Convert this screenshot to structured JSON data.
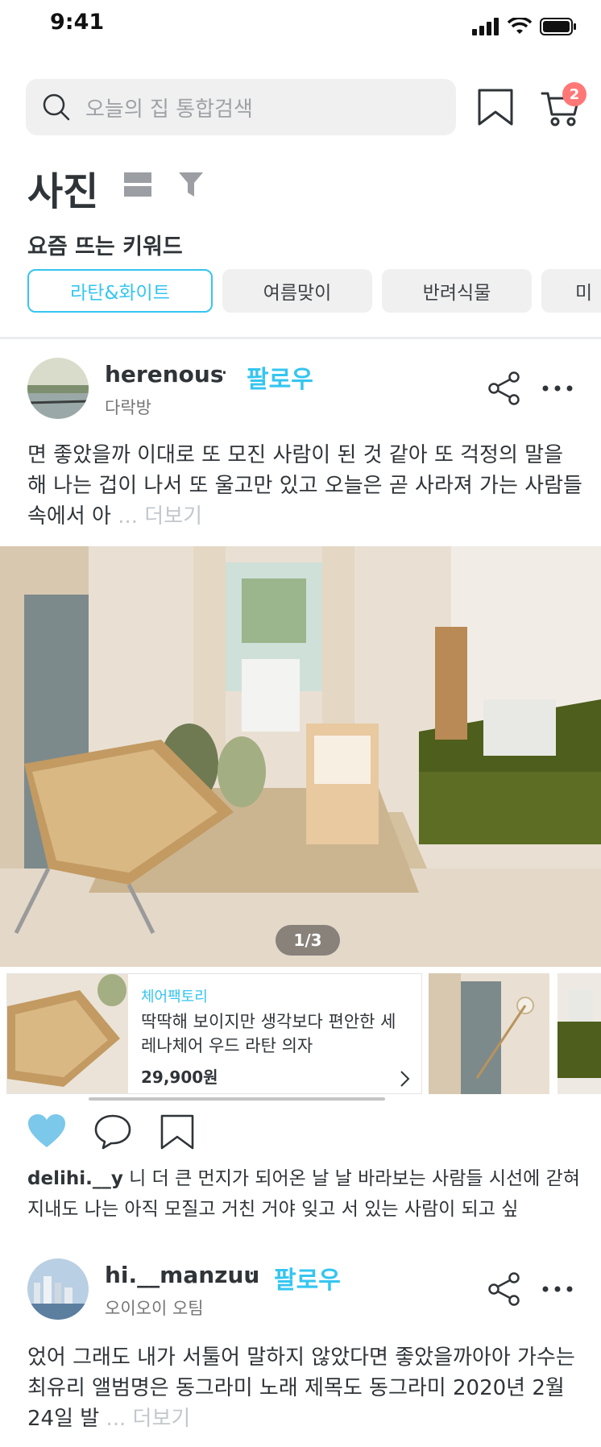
{
  "status_bar": {
    "time": "9:41"
  },
  "search": {
    "placeholder": "오늘의 집 통합검색"
  },
  "cart": {
    "badge_count": "2"
  },
  "page": {
    "title": "사진"
  },
  "keywords": {
    "title": "요즘 뜨는 키워드",
    "chips": [
      "라탄&화이트",
      "여름맞이",
      "반려식물",
      "미"
    ]
  },
  "posts": [
    {
      "username": "herenous",
      "separator": "·",
      "follow_label": "팔로우",
      "room": "다락방",
      "text": "면 좋았을까 이대로 또 모진 사람이 된 것 같아 또 걱정의 말을 해 나는 겁이 나서 또 울고만 있고 오늘은 곧 사라져 가는 사람들 속에서 아",
      "more_label": "... 더보기",
      "photo_counter": "1/3"
    },
    {
      "username": "hi.__manzuu",
      "separator": "·",
      "follow_label": "팔로우",
      "room": "오이오이 오팀",
      "text": "었어 그래도 내가 서툴어 말하지 않았다면 좋았을까아아 가수는 최유리 앨범명은 동그라미 노래 제목도 동그라미 2020년 2월 24일 발",
      "more_label": "... 더보기"
    }
  ],
  "product": {
    "brand": "체어팩토리",
    "name": "딱딱해 보이지만 생각보다 편안한 세레나체어 우드 라탄 의자",
    "price": "29,900원"
  },
  "comment": {
    "user": "delihi.__y",
    "text": " 니 더 큰 먼지가 되어온 날 날 바라보는 사람들 시선에 갇혀 지내도 나는 아직 모질고 거친 거야 잊고 서 있는 사람이 되고 싶"
  },
  "colors": {
    "accent": "#35c5f0",
    "badge": "#ff7777",
    "heart": "#7cc8ea"
  },
  "icons": [
    "search-icon",
    "bookmark-icon",
    "cart-icon",
    "view-toggle-icon",
    "filter-icon",
    "share-icon",
    "more-icon",
    "heart-icon",
    "comment-icon",
    "chevron-right-icon"
  ]
}
